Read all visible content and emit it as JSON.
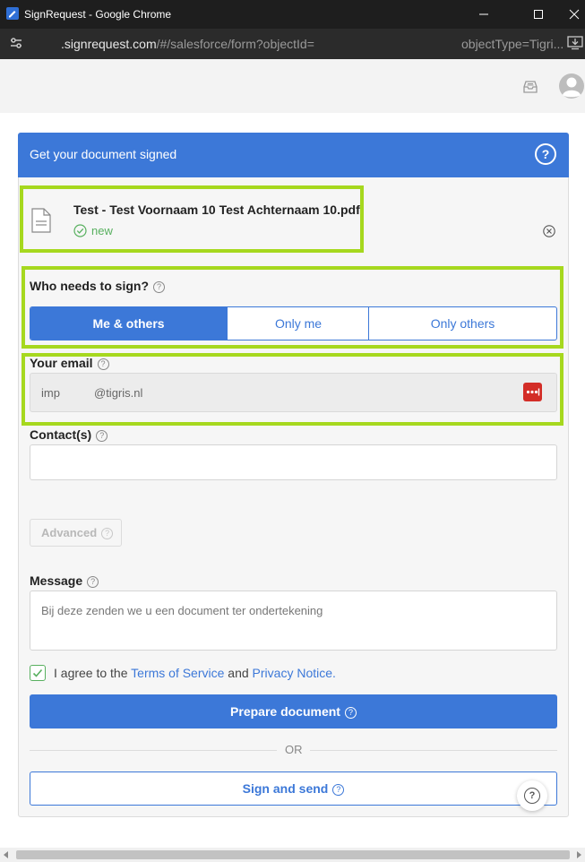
{
  "window": {
    "title": "SignRequest - Google Chrome",
    "controls": [
      "minimize-icon",
      "maximize-icon",
      "close-icon"
    ]
  },
  "address_bar": {
    "host": ".signrequest.com",
    "path": "/#/salesforce/form?objectId=",
    "path_tail": "objectType=Tigri..."
  },
  "form": {
    "header_title": "Get your document signed",
    "file": {
      "name": "Test - Test Voornaam 10 Test Achternaam 10.pdf",
      "status": "new"
    },
    "who_label": "Who needs to sign?",
    "who_options": [
      {
        "label": "Me & others",
        "selected": true
      },
      {
        "label": "Only me",
        "selected": false
      },
      {
        "label": "Only others",
        "selected": false
      }
    ],
    "email_label": "Your email",
    "email_value_prefix": "imp",
    "email_value_domain": "@tigris.nl",
    "contacts_label": "Contact(s)",
    "contacts_value": "",
    "advanced_label": "Advanced",
    "message_label": "Message",
    "message_value": "Bij deze zenden we u een document ter ondertekening",
    "agree": {
      "checked": true,
      "prefix": "I agree to the",
      "terms_link": "Terms of Service",
      "and": "and",
      "privacy_link": "Privacy Notice."
    },
    "prepare_button": "Prepare document",
    "or_text": "OR",
    "sign_send_button": "Sign and send"
  },
  "colors": {
    "accent": "#3c78d8",
    "highlight": "#a6d81e",
    "success": "#58b05f"
  }
}
